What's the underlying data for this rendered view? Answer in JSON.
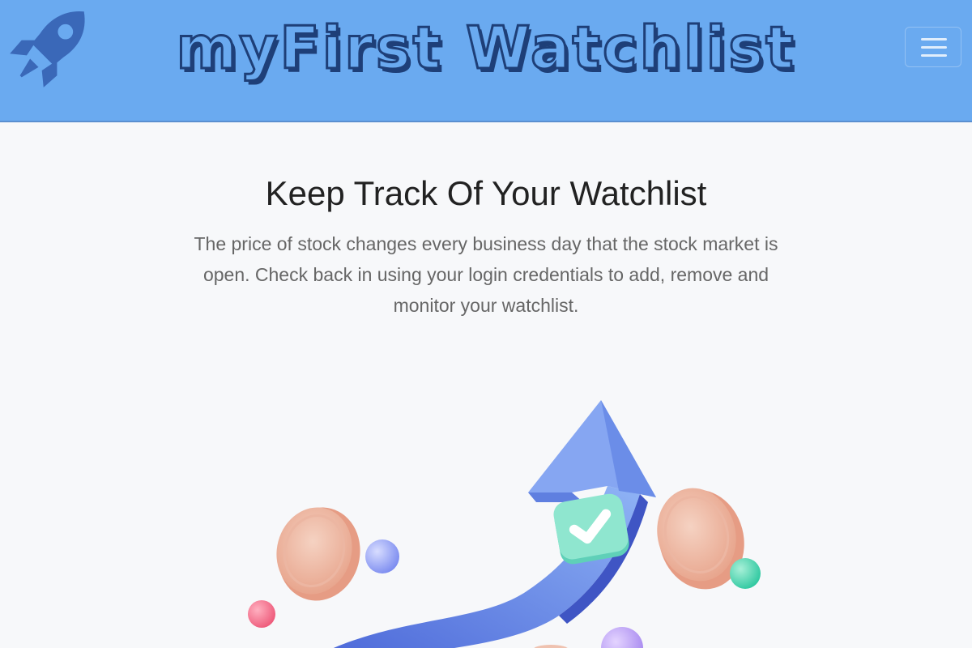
{
  "navbar": {
    "brand": "myFirst Watchlist",
    "logo_icon": "rocket-icon",
    "menu_icon": "hamburger-menu-icon",
    "background_color": "#6aaaf0"
  },
  "hero": {
    "title": "Keep Track Of Your Watchlist",
    "description": "The price of stock changes every business day that the stock market is open. Check back in using your login credentials to add, remove and monitor your watchlist.",
    "illustration_icon": "rising-arrow-coins-illustration"
  }
}
